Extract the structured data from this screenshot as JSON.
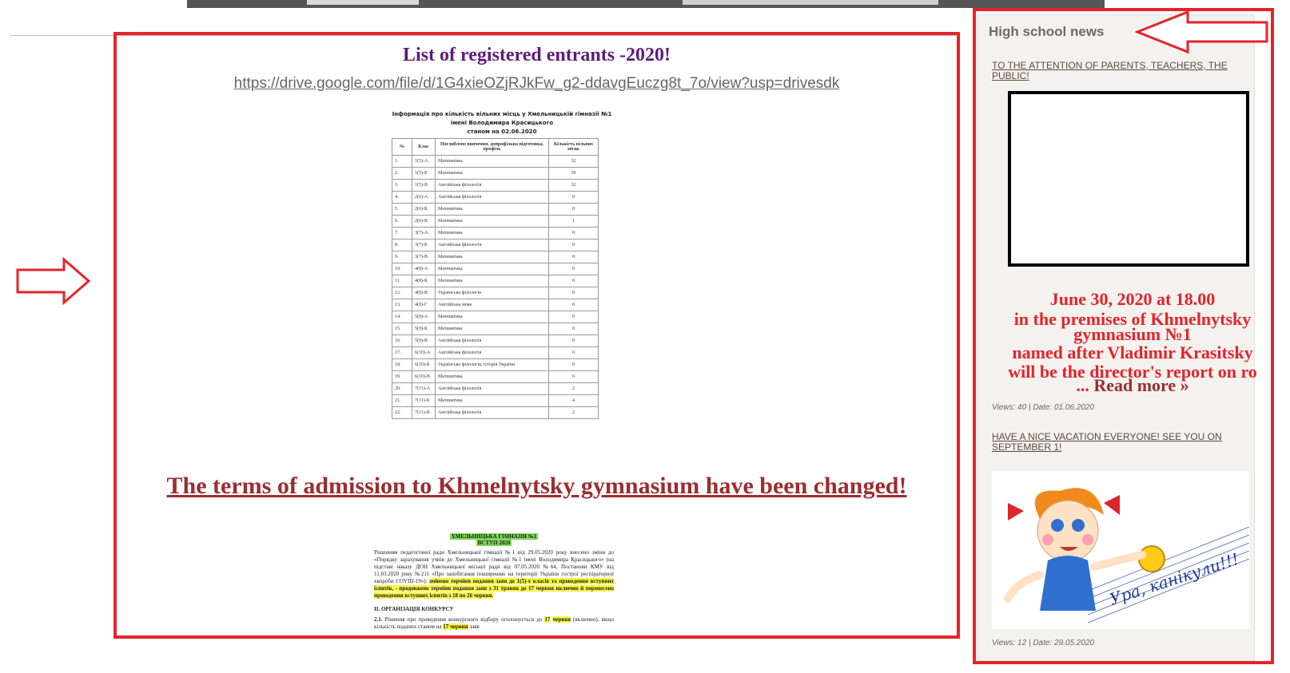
{
  "main": {
    "list_title": "List of registered entrants -2020!",
    "drive_link": "https://drive.google.com/file/d/1G4xieOZjRJkFw_g2-ddavgEuczg8t_7o/view?usp=drivesdk",
    "terms_link": "The terms of admission to Khmelnytsky gymnasium have been changed!",
    "doc1": {
      "title_lines": [
        "Інформація про кількість вільних місць у Хмельницькій гімназії №1",
        "імені Володимира Красицького",
        "станом на 02.06.2020"
      ],
      "columns": [
        "№",
        "Клас",
        "Поглиблене вивчення, допрофільна підготовка, профіль",
        "Кількість вільних місць"
      ],
      "rows": [
        [
          "1.",
          "1(5)-А",
          "Математика",
          "32"
        ],
        [
          "2.",
          "1(5)-Б",
          "Математика",
          "30"
        ],
        [
          "3.",
          "1(5)-В",
          "Англійська філологія",
          "32"
        ],
        [
          "4.",
          "2(6)-А",
          "Англійська філологія",
          "0"
        ],
        [
          "5.",
          "2(6)-Б",
          "Математика",
          "0"
        ],
        [
          "6.",
          "2(6)-В",
          "Математика",
          "1"
        ],
        [
          "7.",
          "3(7)-А",
          "Математика",
          "0"
        ],
        [
          "8.",
          "3(7)-Б",
          "Англійська філологія",
          "0"
        ],
        [
          "9.",
          "3(7)-В",
          "Математика",
          "0"
        ],
        [
          "10.",
          "4(8)-А",
          "Математика",
          "0"
        ],
        [
          "11.",
          "4(8)-Б",
          "Математика",
          "0"
        ],
        [
          "12.",
          "4(8)-В",
          "Українська філологія",
          "0"
        ],
        [
          "13.",
          "4(8)-Г",
          "Англійська мова",
          "0"
        ],
        [
          "14.",
          "5(9)-А",
          "Математика",
          "0"
        ],
        [
          "15.",
          "5(9)-Б",
          "Математика",
          "0"
        ],
        [
          "16.",
          "5(9)-В",
          "Англійська філологія",
          "0"
        ],
        [
          "17.",
          "6(10)-А",
          "Англійська філологія",
          "0"
        ],
        [
          "18.",
          "6(10)-Б",
          "Українська філологія, історія України",
          "0"
        ],
        [
          "19.",
          "6(10)-В",
          "Математика",
          "0"
        ],
        [
          "20.",
          "7(11)-А",
          "Англійська філологія",
          "2"
        ],
        [
          "21.",
          "7(11)-Б",
          "Математика",
          "4"
        ],
        [
          "22.",
          "7(11)-В",
          "Англійська філологія",
          "2"
        ]
      ]
    },
    "doc2": {
      "heading1": "ХМЕЛЬНИЦЬКА ГІМНАЗІЯ №1",
      "heading2": "ВСТУП 2020",
      "para1": "Рішенням педагогічної ради Хмельницької гімназії №1 від 29.05.2020 року внесено зміни до «Порядку зарахування учнів до Хмельницької гімназії №1 імені Володимира Красицького» (на підставі наказу ДОН Хмельницької міської ради від 07.05.2020 №64, Постанови КМУ від 11.03.2020 року №211 «Про запобігання поширенню на території України гострої респіраторної хвороби COVID-19»):",
      "para1_highlight": "змінено терміни подання заяв до 1(5)-х класів та проведення вступних іспитів, - продовжено терміни подання заяв з 31 травня до 17 червня включно й перенесено проведення вступних іспитів з 18 по 26 червня.",
      "section": "II. ОРГАНІЗАЦІЯ КОНКУРСУ",
      "para2_start": "2.1.",
      "para2": "Рішення про проведення конкурсного відбору оголошується до",
      "para2_hl1": "17",
      "para2_hl2": "червня",
      "para2_rest": "(включно), якщо кількість поданих станом на",
      "para2_hl3": "17 червня",
      "para2_end": "заяв"
    }
  },
  "sidebar": {
    "title": "High school news",
    "news": [
      {
        "title": "TO THE ATTENTION OF PARENTS, TEACHERS, THE PUBLIC!",
        "announce_lines": [
          "June 30, 2020 at 18.00",
          "in the premises of Khmelnytsky",
          "gymnasium №1",
          "named after Vladimir Krasitsky",
          "will be the director's report on ro"
        ],
        "ellipsis": "...",
        "read_more": "Read more »",
        "meta": "Views: 40 | Date: 01.06.2020"
      },
      {
        "title": "HAVE A NICE VACATION EVERYONE! SEE YOU ON SEPTEMBER 1!",
        "image_caption": "Ура, канікули!!!",
        "meta": "Views: 12 | Date: 29.05.2020"
      }
    ]
  },
  "colors": {
    "annotation_red": "#e5232a",
    "title_purple": "#5f1b78",
    "terms_red": "#9a2d30"
  },
  "icons": [
    "arrow-right-annotation",
    "arrow-left-annotation"
  ]
}
